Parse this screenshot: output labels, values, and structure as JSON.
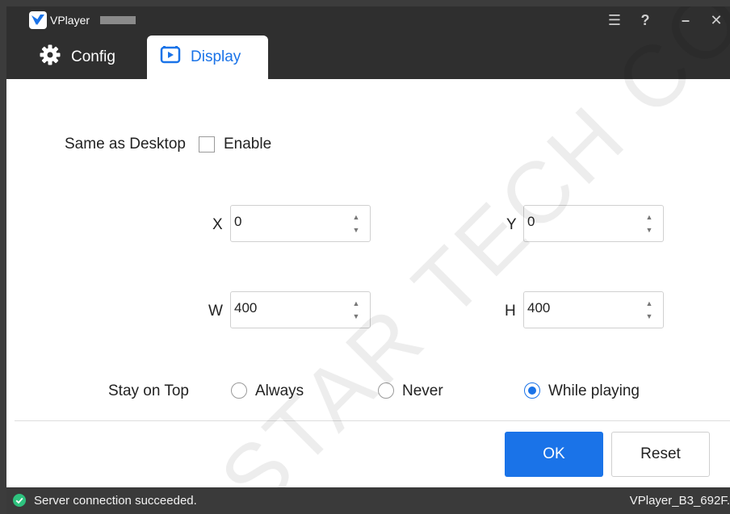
{
  "app": {
    "title": "VPlayer",
    "accent_color": "#1a73e8"
  },
  "window_controls": {
    "menu": "☰",
    "help": "?",
    "minimize": "–",
    "close": "✕"
  },
  "tabs": [
    {
      "label": "Config",
      "icon": "gear-icon",
      "active": false
    },
    {
      "label": "Display",
      "icon": "play-screen-icon",
      "active": true
    }
  ],
  "display": {
    "same_as_desktop_label": "Same as Desktop",
    "enable_label": "Enable",
    "enable_checked": false,
    "x": {
      "label": "X",
      "value": "0"
    },
    "y": {
      "label": "Y",
      "value": "0"
    },
    "w": {
      "label": "W",
      "value": "400"
    },
    "h": {
      "label": "H",
      "value": "400"
    },
    "stay_on_top": {
      "label": "Stay on Top",
      "options": [
        "Always",
        "Never",
        "While playing"
      ],
      "selected": "While playing"
    }
  },
  "buttons": {
    "ok": "OK",
    "reset": "Reset"
  },
  "status": {
    "message": "Server connection succeeded.",
    "version": "VPlayer_B3_692F.",
    "status_color": "#2ec27e"
  },
  "watermark": "STAR TECH CO"
}
